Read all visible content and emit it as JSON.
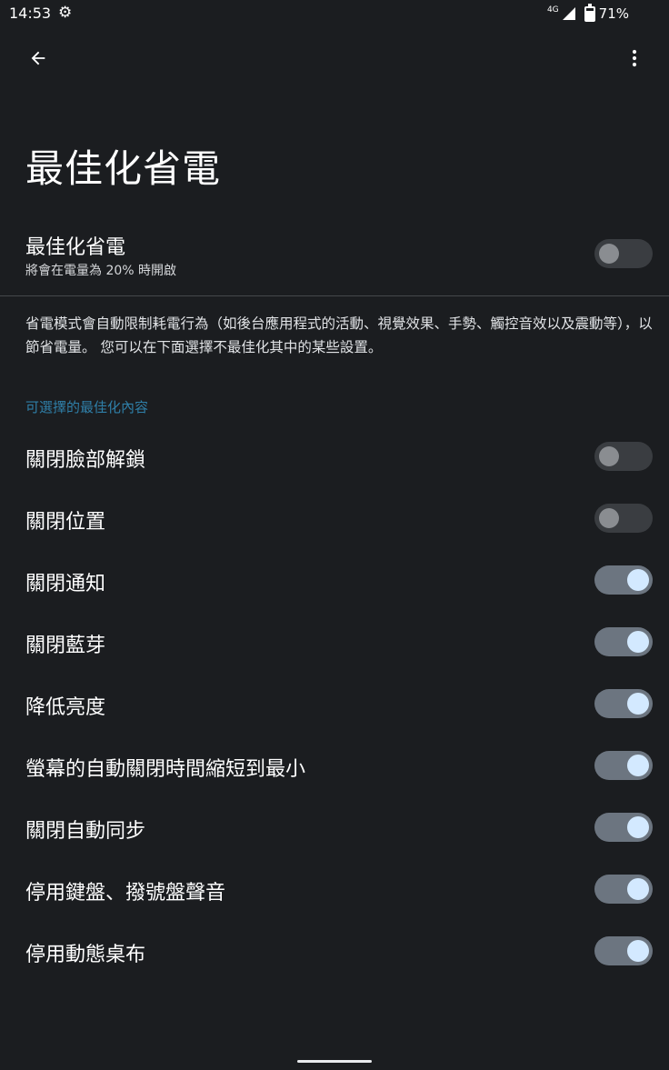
{
  "status_bar": {
    "time": "14:53",
    "network": "4G",
    "battery": "71%"
  },
  "icons": {
    "settings": "gear-icon",
    "back": "arrow-left-icon",
    "menu": "more-vert-icon"
  },
  "page": {
    "title": "最佳化省電"
  },
  "master": {
    "title": "最佳化省電",
    "summary": "將會在電量為 20% 時開啟",
    "state": "off"
  },
  "description": "省電模式會自動限制耗電行為（如後台應用程式的活動、視覺效果、手勢、觸控音效以及震動等），以節省電量。 您可以在下面選擇不最佳化其中的某些設置。",
  "section": {
    "header": "可選擇的最佳化內容"
  },
  "options": [
    {
      "label": "關閉臉部解鎖",
      "state": "off"
    },
    {
      "label": "關閉位置",
      "state": "off"
    },
    {
      "label": "關閉通知",
      "state": "on"
    },
    {
      "label": "關閉藍芽",
      "state": "on"
    },
    {
      "label": "降低亮度",
      "state": "on"
    },
    {
      "label": "螢幕的自動關閉時間縮短到最小",
      "state": "on"
    },
    {
      "label": "關閉自動同步",
      "state": "on"
    },
    {
      "label": "停用鍵盤、撥號盤聲音",
      "state": "on"
    },
    {
      "label": "停用動態桌布",
      "state": "on"
    }
  ],
  "colors": {
    "background": "#1b1d20",
    "accent": "#2f7fa8",
    "switch_on_track": "#6c7580",
    "switch_on_thumb": "#d3e9ff",
    "switch_off_track": "#3a3d41",
    "switch_off_thumb": "#8a8d91"
  }
}
